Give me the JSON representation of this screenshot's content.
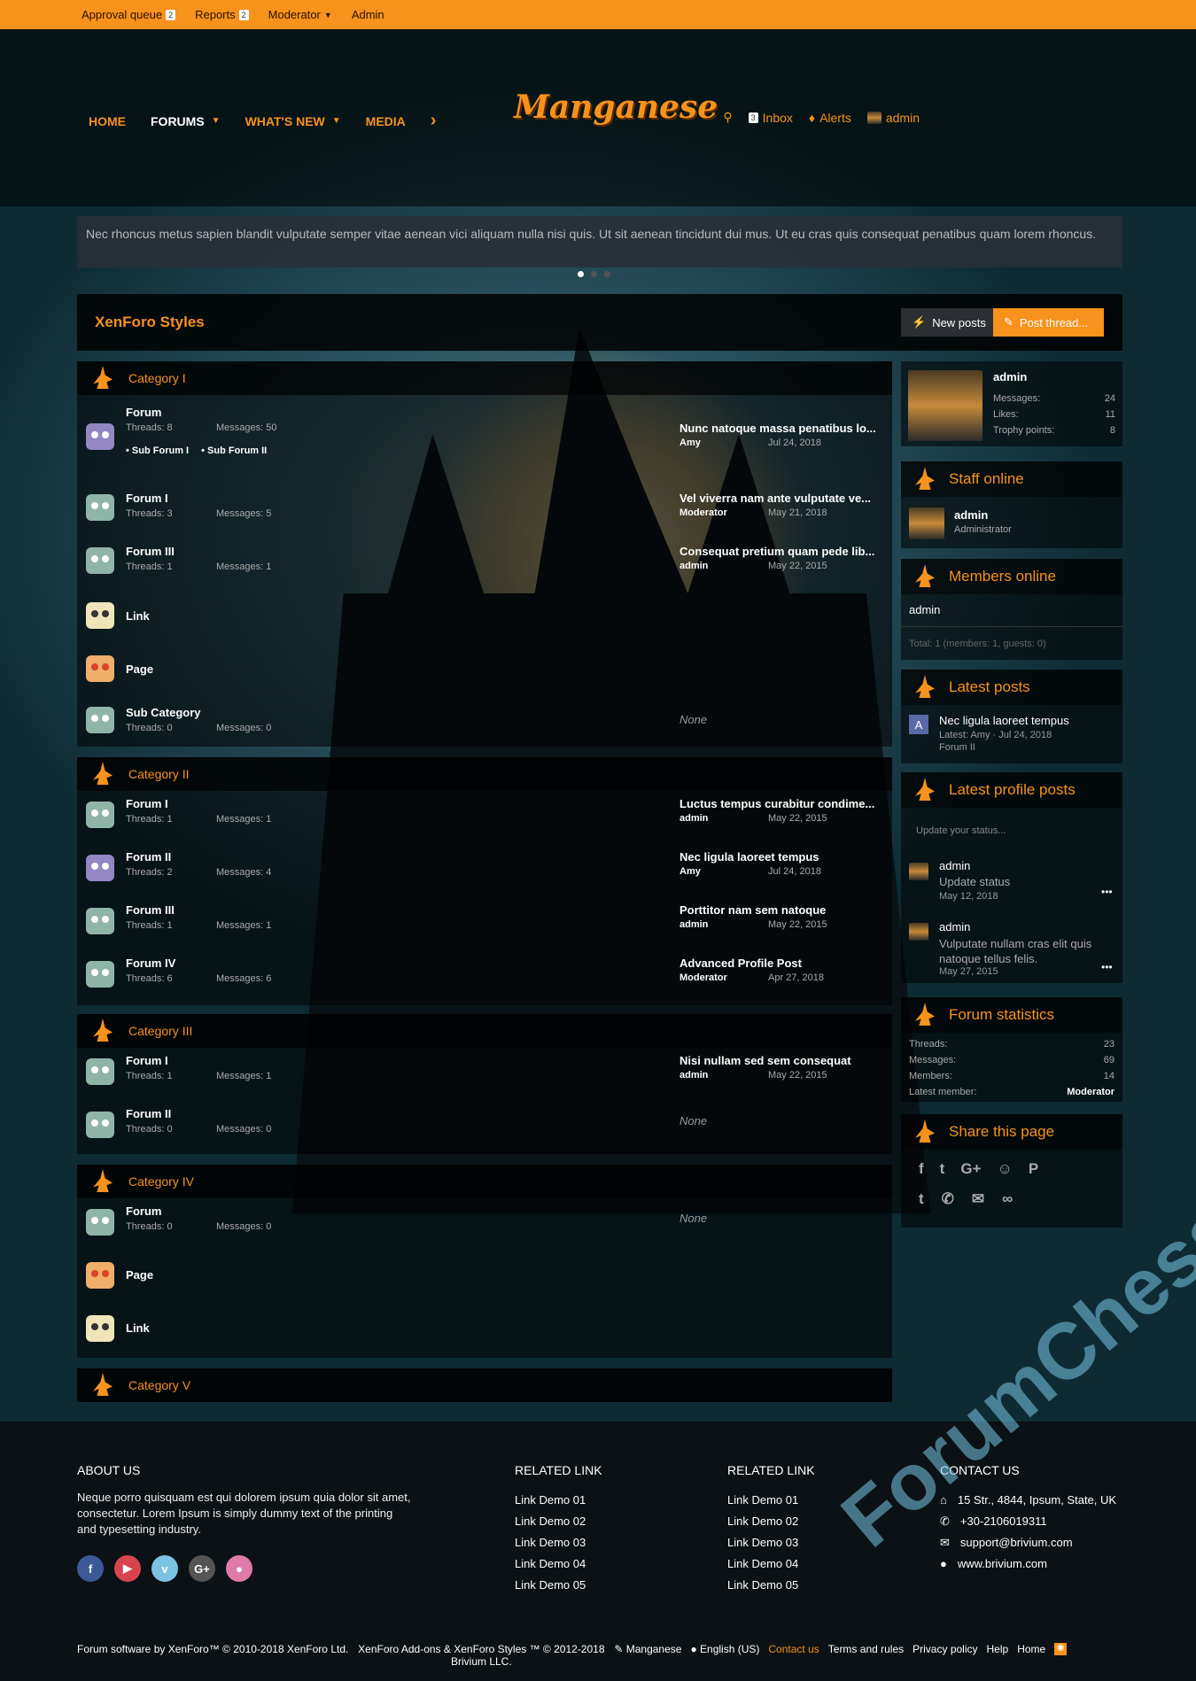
{
  "topbar": {
    "approval": "Approval queue",
    "approval_count": "2",
    "reports": "Reports",
    "reports_count": "2",
    "moderator": "Moderator",
    "admin": "Admin"
  },
  "nav": {
    "home": "HOME",
    "forums": "FORUMS",
    "whats_new": "WHAT'S NEW",
    "media": "MEDIA"
  },
  "logo": "Manganese",
  "usernav": {
    "inbox_count": "3",
    "inbox": "Inbox",
    "alerts": "Alerts",
    "user": "admin"
  },
  "notice": "Nec rhoncus metus sapien blandit vulputate semper vitae aenean vici aliquam nulla nisi quis. Ut sit aenean tincidunt dui mus. Ut eu cras quis consequat penatibus quam lorem rhoncus.",
  "page_title": "XenForo Styles",
  "buttons": {
    "new_posts": "New posts",
    "post_thread": "Post thread..."
  },
  "categories": [
    {
      "title": "Category I",
      "forums": [
        {
          "name": "Forum",
          "threads": "Threads: 8",
          "messages": "Messages: 50",
          "subs": [
            "Sub Forum I",
            "Sub Forum II"
          ],
          "last_title": "Nunc natoque massa penatibus lo...",
          "last_user": "Amy",
          "last_date": "Jul 24, 2018"
        },
        {
          "name": "Forum I",
          "threads": "Threads: 3",
          "messages": "Messages: 5",
          "last_title": "Vel viverra nam ante vulputate ve...",
          "last_user": "Moderator",
          "last_date": "May 21, 2018"
        },
        {
          "name": "Forum III",
          "threads": "Threads: 1",
          "messages": "Messages: 1",
          "last_title": "Consequat pretium quam pede lib...",
          "last_user": "admin",
          "last_date": "May 22, 2015"
        },
        {
          "name": "Link"
        },
        {
          "name": "Page"
        },
        {
          "name": "Sub Category",
          "threads": "Threads: 0",
          "messages": "Messages: 0",
          "none": "None"
        }
      ]
    },
    {
      "title": "Category II",
      "forums": [
        {
          "name": "Forum I",
          "threads": "Threads: 1",
          "messages": "Messages: 1",
          "last_title": "Luctus tempus curabitur condime...",
          "last_user": "admin",
          "last_date": "May 22, 2015"
        },
        {
          "name": "Forum II",
          "threads": "Threads: 2",
          "messages": "Messages: 4",
          "last_title": "Nec ligula laoreet tempus",
          "last_user": "Amy",
          "last_date": "Jul 24, 2018"
        },
        {
          "name": "Forum III",
          "threads": "Threads: 1",
          "messages": "Messages: 1",
          "last_title": "Porttitor nam sem natoque",
          "last_user": "admin",
          "last_date": "May 22, 2015"
        },
        {
          "name": "Forum IV",
          "threads": "Threads: 6",
          "messages": "Messages: 6",
          "last_title": "Advanced Profile Post",
          "last_user": "Moderator",
          "last_date": "Apr 27, 2018"
        }
      ]
    },
    {
      "title": "Category III",
      "forums": [
        {
          "name": "Forum I",
          "threads": "Threads: 1",
          "messages": "Messages: 1",
          "last_title": "Nisi nullam sed sem consequat",
          "last_user": "admin",
          "last_date": "May 22, 2015"
        },
        {
          "name": "Forum II",
          "threads": "Threads: 0",
          "messages": "Messages: 0",
          "none": "None"
        }
      ]
    },
    {
      "title": "Category IV",
      "forums": [
        {
          "name": "Forum",
          "threads": "Threads: 0",
          "messages": "Messages: 0",
          "none": "None"
        },
        {
          "name": "Page"
        },
        {
          "name": "Link"
        }
      ]
    },
    {
      "title": "Category V"
    }
  ],
  "profile": {
    "name": "admin",
    "messages_label": "Messages:",
    "messages": "24",
    "likes_label": "Likes:",
    "likes": "11",
    "trophy_label": "Trophy points:",
    "trophy": "8"
  },
  "staff": {
    "title": "Staff online",
    "name": "admin",
    "role": "Administrator"
  },
  "members": {
    "title": "Members online",
    "name": "admin",
    "total": "Total: 1 (members: 1, guests: 0)"
  },
  "latest_posts": {
    "title": "Latest posts",
    "avatar_letter": "A",
    "post": "Nec ligula laoreet tempus",
    "meta": "Latest: Amy · Jul 24, 2018",
    "forum": "Forum II"
  },
  "profile_posts": {
    "title": "Latest profile posts",
    "placeholder": "Update your status...",
    "items": [
      {
        "name": "admin",
        "text": "Update status",
        "date": "May 12, 2018"
      },
      {
        "name": "admin",
        "text": "Vulputate nullam cras elit quis natoque tellus felis.",
        "date": "May 27, 2015"
      }
    ]
  },
  "stats": {
    "title": "Forum statistics",
    "threads_label": "Threads:",
    "threads": "23",
    "messages_label": "Messages:",
    "messages": "69",
    "members_label": "Members:",
    "members": "14",
    "latest_label": "Latest member:",
    "latest": "Moderator"
  },
  "share": {
    "title": "Share this page"
  },
  "footer": {
    "about_title": "ABOUT US",
    "about_text": "Neque porro quisquam est qui dolorem ipsum quia dolor sit amet, consectetur. Lorem Ipsum is simply dummy text of the printing and typesetting industry.",
    "related1_title": "RELATED LINK",
    "related2_title": "RELATED LINK",
    "links": [
      "Link Demo 01",
      "Link Demo 02",
      "Link Demo 03",
      "Link Demo 04",
      "Link Demo 05"
    ],
    "contact_title": "CONTACT US",
    "address": "15 Str., 4844, Ipsum, State, UK",
    "phone": "+30-2106019311",
    "email": "support@brivium.com",
    "web": "www.brivium.com",
    "copy1": "Forum software by XenForo™ © 2010-2018 XenForo Ltd.",
    "copy2": "XenForo Add-ons & XenForo Styles ™ © 2012-2018 Brivium LLC.",
    "style": "Manganese",
    "lang": "English (US)",
    "contact": "Contact us",
    "terms": "Terms and rules",
    "privacy": "Privacy policy",
    "help": "Help",
    "home": "Home"
  },
  "watermark": "ForumChess"
}
